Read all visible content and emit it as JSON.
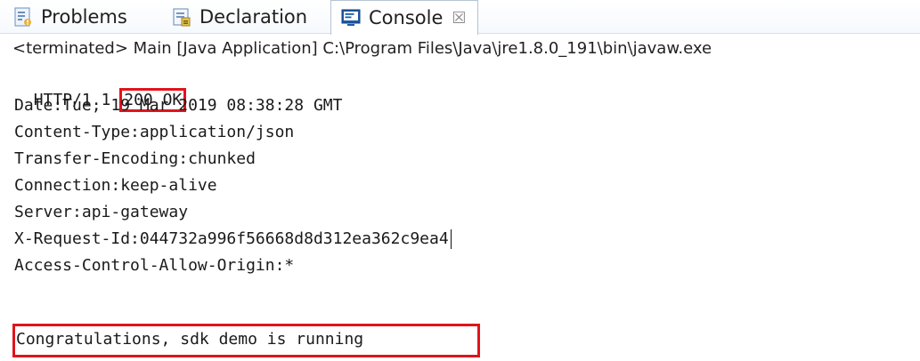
{
  "tabs": [
    {
      "label": "Problems",
      "icon": "problems-icon"
    },
    {
      "label": "Declaration",
      "icon": "declaration-icon"
    },
    {
      "label": "Console",
      "icon": "console-icon",
      "close": "☒"
    }
  ],
  "status": "<terminated> Main [Java Application] C:\\Program Files\\Java\\jre1.8.0_191\\bin\\javaw.exe",
  "console": {
    "http_version": "HTTP/1.1 ",
    "http_status": "200 OK",
    "lines": [
      "Date:Tue, 19 Mar 2019 08:38:28 GMT",
      "Content-Type:application/json",
      "Transfer-Encoding:chunked",
      "Connection:keep-alive",
      "Server:api-gateway",
      "X-Request-Id:044732a996f56668d8d312ea362c9ea4",
      "Access-Control-Allow-Origin:*"
    ],
    "congrats": "Congratulations, sdk demo is running"
  },
  "colors": {
    "highlight": "#e0141b",
    "tab_border": "#b7c3d2"
  }
}
